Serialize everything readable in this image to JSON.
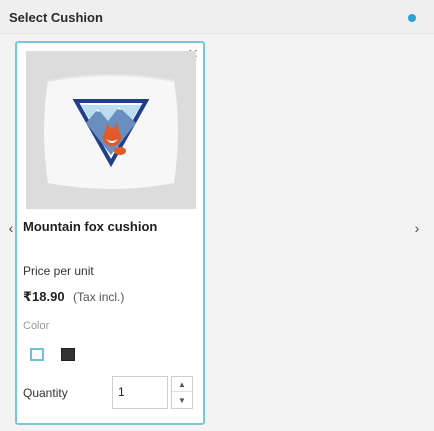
{
  "header": {
    "title": "Select Cushion",
    "status_color": "#2aa3d8"
  },
  "navigation": {
    "prev_icon": "‹",
    "next_icon": "›"
  },
  "product": {
    "name": "Mountain fox cushion",
    "price_label": "Price per unit",
    "price_value": "₹18.90",
    "tax_note": "(Tax incl.)",
    "color_label": "Color",
    "colors": [
      {
        "name": "white",
        "hex": "#ffffff",
        "selected": true
      },
      {
        "name": "black",
        "hex": "#333333",
        "selected": false
      }
    ],
    "quantity_label": "Quantity",
    "quantity_value": "1",
    "close_icon": "×"
  },
  "colors": {
    "accent": "#79c6d9",
    "background": "#f3f3f3"
  }
}
